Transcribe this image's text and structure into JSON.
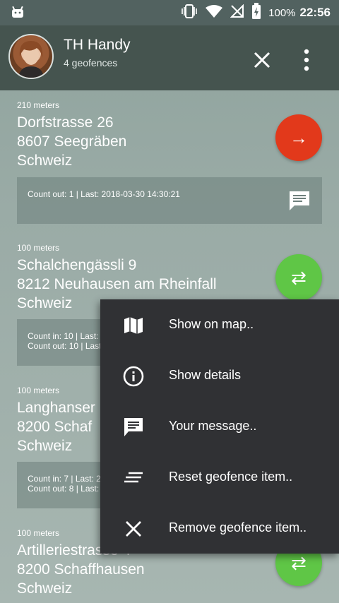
{
  "status_bar": {
    "battery": "100%",
    "time": "22:56"
  },
  "header": {
    "title": "TH Handy",
    "subtitle": "4 geofences"
  },
  "items": [
    {
      "distance": "210 meters",
      "address": [
        "Dorfstrasse 26",
        "8607 Seegräben",
        "Schweiz"
      ],
      "fab_color": "#e2391b",
      "fab_icon": "arrow-right-icon",
      "fab_glyph": "→",
      "counts": "Count out: 1 | Last: 2018-03-30 14:30:21"
    },
    {
      "distance": "100 meters",
      "address": [
        "Schalchengässli 9",
        "8212 Neuhausen am Rheinfall",
        "Schweiz"
      ],
      "fab_color": "#5fc646",
      "fab_icon": "swap-arrows-icon",
      "fab_glyph": "⇄",
      "counts": "Count in: 10 | Last:\nCount out: 10 | Last"
    },
    {
      "distance": "100 meters",
      "address": [
        "Langhanser",
        "8200 Schaf",
        "Schweiz"
      ],
      "counts": "Count in: 7 | Last: 2\nCount out: 8 | Last:"
    },
    {
      "distance": "100 meters",
      "address": [
        "Artilleriestrasse 4",
        "8200 Schaffhausen",
        "Schweiz"
      ],
      "fab_color": "#5fc646",
      "fab_icon": "swap-arrows-icon",
      "fab_glyph": "⇄"
    }
  ],
  "menu": {
    "items": [
      {
        "label": "Show on map..",
        "icon": "map-icon"
      },
      {
        "label": "Show details",
        "icon": "info-icon"
      },
      {
        "label": "Your message..",
        "icon": "message-icon"
      },
      {
        "label": "Reset geofence item..",
        "icon": "reset-lines-icon"
      },
      {
        "label": "Remove geofence item..",
        "icon": "close-icon"
      }
    ]
  }
}
